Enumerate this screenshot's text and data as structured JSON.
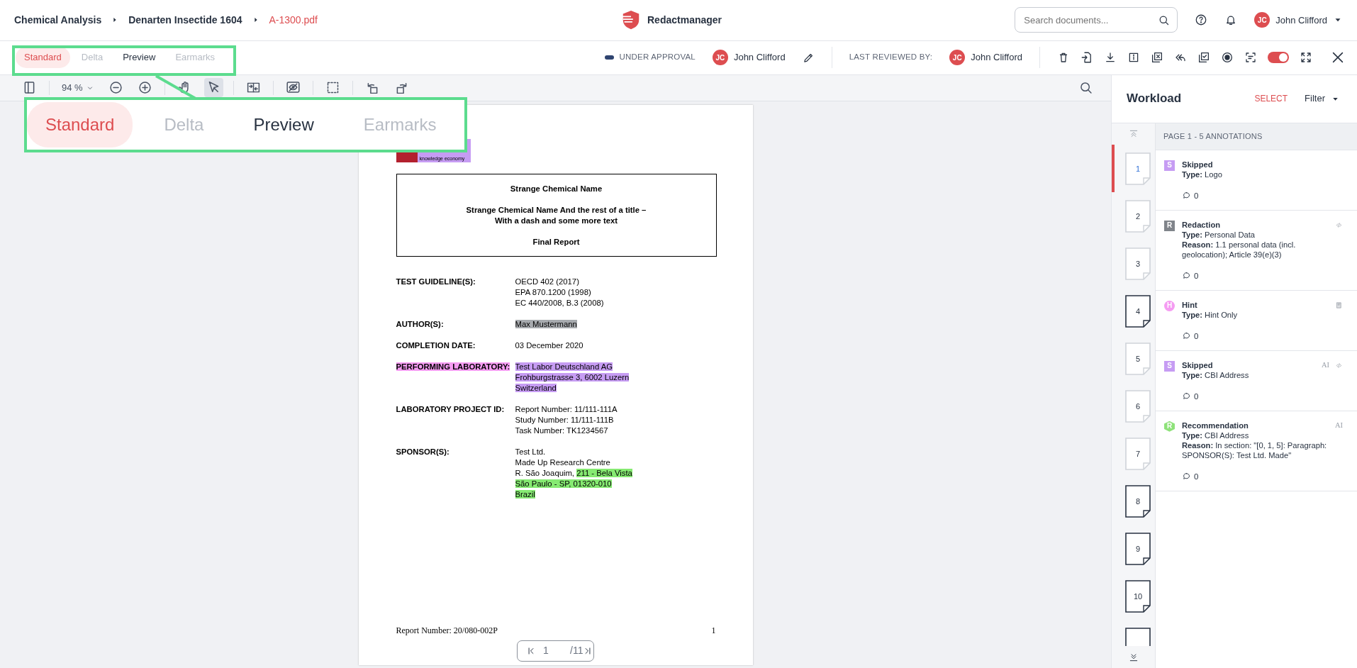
{
  "breadcrumbs": [
    {
      "text": "Chemical Analysis",
      "current": false
    },
    {
      "text": "Denarten Insectide 1604",
      "current": false
    },
    {
      "text": "A-1300.pdf",
      "current": true
    }
  ],
  "app": {
    "name": "Redactmanager"
  },
  "search": {
    "placeholder": "Search documents..."
  },
  "user": {
    "initials": "JC",
    "name": "John Clifford"
  },
  "tabs": [
    {
      "label": "Standard",
      "selected": true,
      "disabled": false
    },
    {
      "label": "Delta",
      "selected": false,
      "disabled": true
    },
    {
      "label": "Preview",
      "selected": false,
      "disabled": false
    },
    {
      "label": "Earmarks",
      "selected": false,
      "disabled": true
    }
  ],
  "status": {
    "label": "UNDER APPROVAL",
    "color": "#2f4470",
    "initials": "JC",
    "name": "John Clifford"
  },
  "last_reviewed": {
    "label": "LAST REVIEWED BY:",
    "initials": "JC",
    "name": "John Clifford"
  },
  "actions": [
    {
      "kind": "trash"
    },
    {
      "kind": "import"
    },
    {
      "kind": "download"
    },
    {
      "kind": "info"
    },
    {
      "kind": "image-x"
    },
    {
      "kind": "reply-all"
    },
    {
      "kind": "check-box"
    },
    {
      "kind": "record"
    },
    {
      "kind": "scan"
    },
    {
      "kind": "toggle",
      "on": true
    },
    {
      "kind": "expand"
    },
    {
      "kind": "close"
    }
  ],
  "toolbar": {
    "zoom": "94 %",
    "tools": [
      {
        "kind": "sidebar",
        "selected": false
      },
      {
        "kind": "zoom",
        "selected": false
      },
      {
        "kind": "zoom-out",
        "selected": false
      },
      {
        "kind": "zoom-in",
        "selected": false
      },
      {
        "kind": "hand",
        "selected": false
      },
      {
        "kind": "pointer",
        "selected": true
      },
      {
        "kind": "compare",
        "selected": false
      },
      {
        "kind": "eye-off",
        "selected": false
      },
      {
        "kind": "select-area",
        "selected": false
      },
      {
        "kind": "rotate-left",
        "selected": false
      },
      {
        "kind": "rotate-right",
        "selected": false
      }
    ]
  },
  "document": {
    "logo": {
      "tagline": "knowledge economy",
      "color": "#c69cf3"
    },
    "title_blocks": [
      [
        "Strange Chemical Name"
      ],
      [
        "Strange Chemical Name And the rest of a title –",
        "With a dash and some more text"
      ],
      [
        "Final Report"
      ]
    ],
    "fields": [
      {
        "label": {
          "text": "TEST GUIDELINE(S):"
        },
        "lines": [
          [
            {
              "text": "OECD 402 (2017)"
            }
          ],
          [
            {
              "text": "EPA 870.1200 (1998)"
            }
          ],
          [
            {
              "text": "EC 440/2008, B.3 (2008)"
            }
          ]
        ]
      },
      {
        "label": {
          "text": "AUTHOR(S):"
        },
        "lines": [
          [
            {
              "text": "Max Mustermann",
              "color": "#a7aaae"
            }
          ]
        ]
      },
      {
        "label": {
          "text": "COMPLETION DATE:"
        },
        "lines": [
          [
            {
              "text": "03 December 2020"
            }
          ]
        ]
      },
      {
        "label": {
          "text": "PERFORMING LABORATORY:",
          "color": "#f59cf2"
        },
        "lines": [
          [
            {
              "text": "Test Labor Deutschland AG",
              "color": "#c69cf3"
            }
          ],
          [
            {
              "text": "Frohburgstrasse 3, 6002 Luzern",
              "color": "#c69cf3"
            }
          ],
          [
            {
              "text": "Switzerland",
              "color": "#c69cf3"
            }
          ]
        ]
      },
      {
        "label": {
          "text": "LABORATORY PROJECT ID:"
        },
        "lines": [
          [
            {
              "text": "Report Number: 11/111-111A"
            }
          ],
          [
            {
              "text": "Study Number: 11/111-111B"
            }
          ],
          [
            {
              "text": "Task Number: TK1234567"
            }
          ]
        ]
      },
      {
        "label": {
          "text": "SPONSOR(S):"
        },
        "lines": [
          [
            {
              "text": "Test Ltd."
            }
          ],
          [
            {
              "text": "Made Up Research Centre"
            }
          ],
          [
            {
              "text": "R. São Joaquim, "
            },
            {
              "text": "211 - Bela Vista",
              "color": "#86ea72"
            }
          ],
          [
            {
              "text": "São Paulo - SP, 01320-010",
              "color": "#86ea72"
            }
          ],
          [
            {
              "text": "Brazil",
              "color": "#86ea72"
            }
          ]
        ]
      }
    ],
    "footer": {
      "report": "Report Number: 20/080-002P",
      "page": "1"
    }
  },
  "pager": {
    "page": "1",
    "total": "/11"
  },
  "callout": {
    "tabs": [
      {
        "label": "Standard",
        "selected": true,
        "disabled": false
      },
      {
        "label": "Delta",
        "selected": false,
        "disabled": true
      },
      {
        "label": "Preview",
        "selected": false,
        "disabled": false
      },
      {
        "label": "Earmarks",
        "selected": false,
        "disabled": true
      }
    ]
  },
  "workload": {
    "title": "Workload",
    "select": "SELECT",
    "filter": "Filter",
    "section": "PAGE 1 - 5 ANNOTATIONS",
    "pages": [
      {
        "label": "1",
        "selected": true,
        "outlined": false
      },
      {
        "label": "2",
        "selected": false,
        "outlined": false
      },
      {
        "label": "3",
        "selected": false,
        "outlined": false
      },
      {
        "label": "4",
        "selected": false,
        "outlined": true
      },
      {
        "label": "5",
        "selected": false,
        "outlined": false
      },
      {
        "label": "6",
        "selected": false,
        "outlined": false
      },
      {
        "label": "7",
        "selected": false,
        "outlined": false
      },
      {
        "label": "8",
        "selected": false,
        "outlined": true
      },
      {
        "label": "9",
        "selected": false,
        "outlined": true
      },
      {
        "label": "10",
        "selected": false,
        "outlined": true
      },
      {
        "selected": false,
        "outlined": true
      }
    ],
    "annotations": [
      {
        "badge": "S",
        "kind": "square",
        "color": "#c69cf3",
        "title": "Skipped",
        "type": "**Type:** Logo",
        "comments": "0"
      },
      {
        "badge": "R",
        "kind": "square",
        "color": "#80848a",
        "title": "Redaction",
        "type": "**Type:** Personal Data",
        "reason": "**Reason:** 1.1 personal data (incl. geolocation); Article 39(e)(3)",
        "comments": "0",
        "markers": [
          {
            "kind": "code"
          }
        ]
      },
      {
        "badge": "H",
        "kind": "circle",
        "color": "#f59cf2",
        "title": "Hint",
        "type": "**Type:** Hint Only",
        "comments": "0",
        "markers": [
          {
            "kind": "note"
          }
        ]
      },
      {
        "badge": "S",
        "kind": "square",
        "color": "#c69cf3",
        "title": "Skipped",
        "type": "**Type:** CBI Address",
        "comments": "0",
        "markers": [
          {
            "kind": "ai",
            "text": "AI"
          },
          {
            "kind": "code"
          }
        ]
      },
      {
        "badge": "R",
        "kind": "hexagon",
        "color": "#8ee27a",
        "title": "Recommendation",
        "type": "**Type:** CBI Address",
        "reason": "**Reason:** In section: \"[0, 1, 5]: Paragraph: SPONSOR(S): Test Ltd. Made\"",
        "comments": "0",
        "markers": [
          {
            "kind": "ai",
            "text": "AI"
          }
        ]
      }
    ]
  }
}
